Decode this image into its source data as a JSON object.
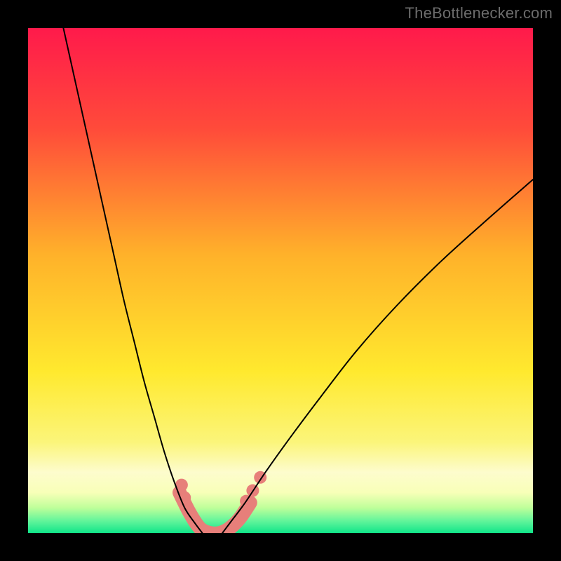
{
  "watermark": "TheBottlenecker.com",
  "chart_data": {
    "type": "line",
    "title": "",
    "xlabel": "",
    "ylabel": "",
    "xlim": [
      0,
      100
    ],
    "ylim": [
      0,
      100
    ],
    "background": {
      "style": "vertical-gradient",
      "top": "#ff1a4b",
      "mid1": "#ff8a2a",
      "mid2": "#ffe92e",
      "band": "#fdfccd",
      "bottom": "#11e58a"
    },
    "series": [
      {
        "name": "left-curve",
        "color": "#000000",
        "x": [
          7,
          9,
          11,
          13,
          15,
          17,
          19,
          21,
          23,
          25,
          27,
          29,
          31,
          33,
          34.5
        ],
        "y": [
          100,
          91,
          82,
          73,
          64,
          55,
          46,
          38,
          30,
          23,
          16,
          10,
          5,
          2,
          0
        ]
      },
      {
        "name": "right-curve",
        "color": "#000000",
        "x": [
          38.5,
          40,
          43,
          47,
          52,
          58,
          65,
          73,
          82,
          92,
          100
        ],
        "y": [
          0,
          2,
          6,
          12,
          19,
          27,
          36,
          45,
          54,
          63,
          70
        ]
      },
      {
        "name": "highlight-band",
        "color": "#e77f7a",
        "x": [
          30,
          32,
          34,
          36,
          38,
          40,
          42,
          44
        ],
        "y": [
          8,
          4,
          1,
          0,
          0,
          1,
          3,
          6
        ]
      }
    ],
    "highlight_dots": {
      "color": "#e77f7a",
      "radius_px": 9,
      "points": [
        {
          "x": 30.4,
          "y": 9.5
        },
        {
          "x": 31.0,
          "y": 7.0
        },
        {
          "x": 43.2,
          "y": 6.3
        },
        {
          "x": 44.5,
          "y": 8.4
        },
        {
          "x": 46.0,
          "y": 11.0
        }
      ]
    }
  }
}
